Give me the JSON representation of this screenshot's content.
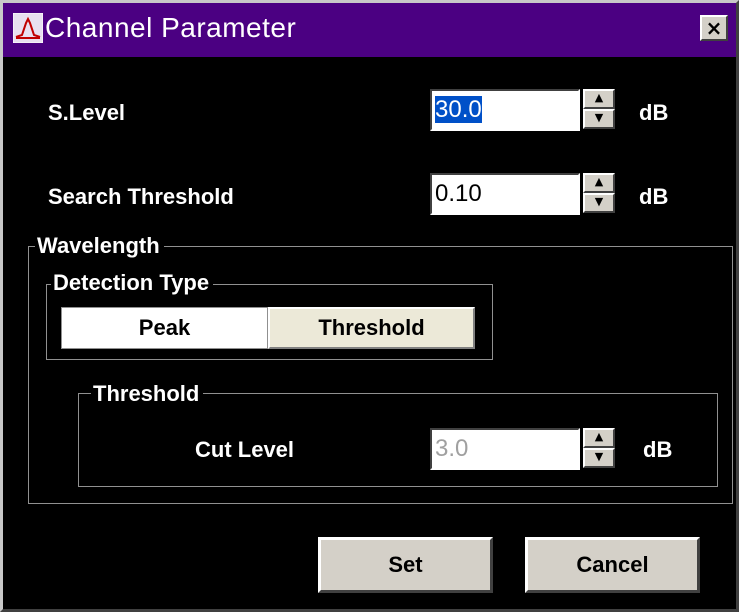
{
  "window": {
    "title": "Channel Parameter",
    "close_glyph": "×",
    "icon": "spectrum-chart-icon"
  },
  "s_level": {
    "label": "S.Level",
    "value": "30.0",
    "unit": "dB"
  },
  "search_threshold": {
    "label": "Search Threshold",
    "value": "0.10",
    "unit": "dB"
  },
  "wavelength": {
    "group_label": "Wavelength",
    "detection_type": {
      "group_label": "Detection Type",
      "options": [
        "Peak",
        "Threshold"
      ],
      "selected": "Threshold"
    },
    "threshold": {
      "group_label": "Threshold",
      "cut_level_label": "Cut Level",
      "cut_level_value": "3.0",
      "unit": "dB"
    }
  },
  "spin_glyphs": {
    "up": "▲",
    "down": "▼"
  },
  "buttons": {
    "set": "Set",
    "cancel": "Cancel"
  },
  "colors": {
    "titlebar": "#4b0082",
    "background": "#000000",
    "selection": "#0050c8"
  }
}
